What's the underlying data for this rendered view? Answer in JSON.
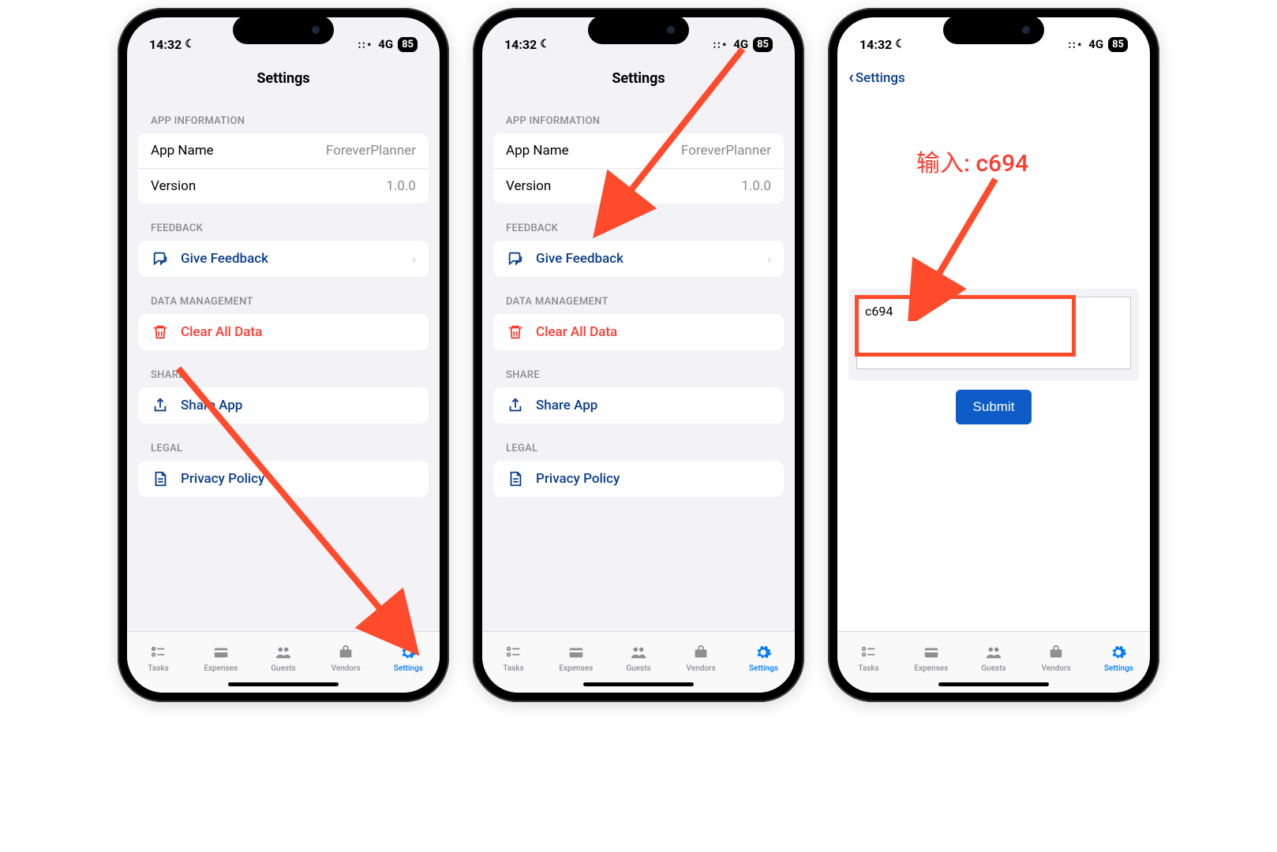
{
  "status": {
    "time": "14:32",
    "signal": "4G",
    "battery": "85"
  },
  "settings": {
    "title": "Settings",
    "sections": {
      "app_info": {
        "header": "APP INFORMATION",
        "app_name_label": "App Name",
        "app_name_value": "ForeverPlanner",
        "version_label": "Version",
        "version_value": "1.0.0"
      },
      "feedback": {
        "header": "FEEDBACK",
        "give_feedback": "Give Feedback"
      },
      "data_mgmt": {
        "header": "DATA MANAGEMENT",
        "clear_all": "Clear All Data"
      },
      "share": {
        "header": "SHARE",
        "share_app": "Share App"
      },
      "legal": {
        "header": "LEGAL",
        "privacy": "Privacy Policy"
      }
    }
  },
  "feedback_page": {
    "back_label": "Settings",
    "input_value": "c694",
    "submit_label": "Submit"
  },
  "tabs": {
    "tasks": "Tasks",
    "expenses": "Expenses",
    "guests": "Guests",
    "vendors": "Vendors",
    "settings": "Settings"
  },
  "annotations": {
    "input_hint": "输入: c694"
  }
}
